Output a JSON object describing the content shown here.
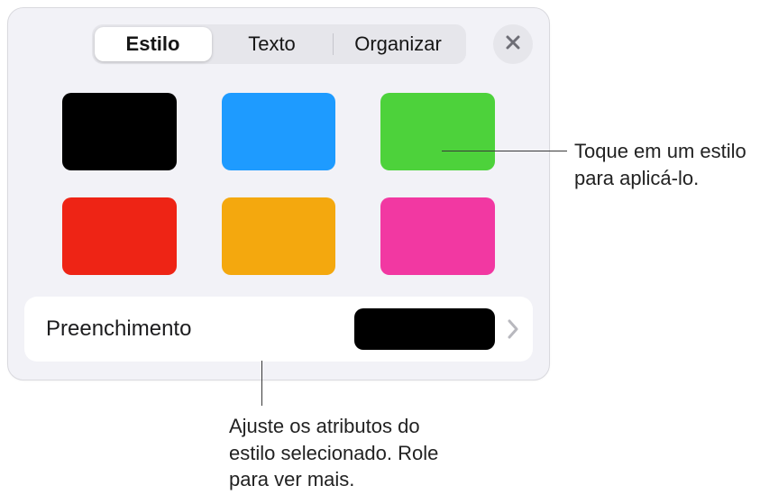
{
  "tabs": {
    "estilo": "Estilo",
    "texto": "Texto",
    "organizar": "Organizar"
  },
  "swatches": [
    {
      "color": "#000000"
    },
    {
      "color": "#1e9bff"
    },
    {
      "color": "#4dd23b"
    },
    {
      "color": "#ee2415"
    },
    {
      "color": "#f4a80e"
    },
    {
      "color": "#f238a2"
    }
  ],
  "fill": {
    "label": "Preenchimento",
    "previewColor": "#000000"
  },
  "callouts": {
    "topRight": "Toque em um estilo para aplicá-lo.",
    "bottom": "Ajuste os atributos do estilo selecionado. Role para ver mais."
  }
}
